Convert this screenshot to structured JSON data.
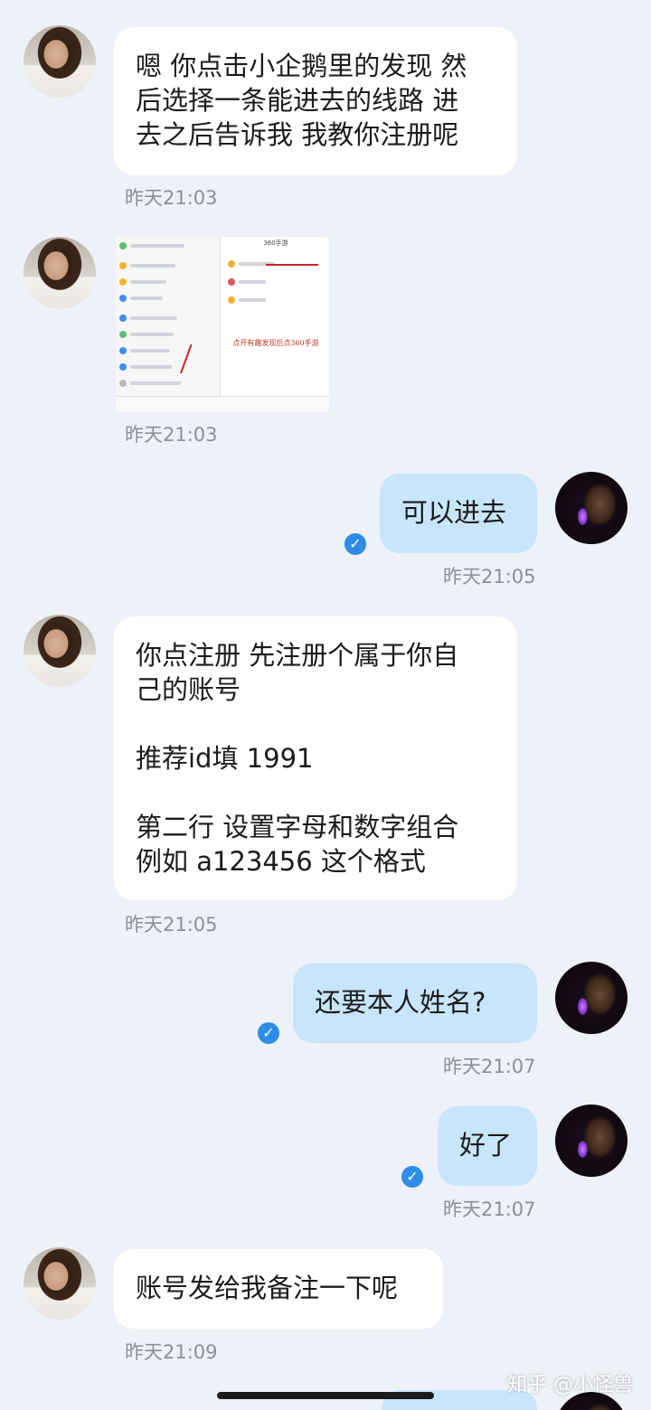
{
  "messages": [
    {
      "from": "her",
      "type": "text",
      "text": "嗯 你点击小企鹅里的发现 然\n后选择一条能进去的线路 进\n去之后告诉我 我教你注册呢",
      "time": "昨天21:03"
    },
    {
      "from": "her",
      "type": "image",
      "image_caption": "点开有趣发现后点360手游",
      "image_header": "360手游",
      "time": "昨天21:03"
    },
    {
      "from": "me",
      "type": "text",
      "text": "可以进去",
      "time": "昨天21:05",
      "read": true
    },
    {
      "from": "her",
      "type": "text",
      "text": "你点注册 先注册个属于你自\n己的账号\n\n推荐id填 1991\n\n第二行 设置字母和数字组合\n例如 a123456 这个格式",
      "time": "昨天21:05"
    },
    {
      "from": "me",
      "type": "text",
      "text": "还要本人姓名?",
      "time": "昨天21:07",
      "read": true
    },
    {
      "from": "me",
      "type": "text",
      "text": "好了",
      "time": "昨天21:07",
      "read": true
    },
    {
      "from": "her",
      "type": "text",
      "text": "账号发给我备注一下呢",
      "time": "昨天21:09"
    }
  ],
  "watermark": "知乎 @小怪兽",
  "icons": {
    "read_receipt": "check-circle-icon"
  },
  "colors": {
    "background": "#eef1f8",
    "incoming_bubble": "#ffffff",
    "outgoing_bubble": "#c7e5fb",
    "read_check": "#2e8ce6"
  }
}
